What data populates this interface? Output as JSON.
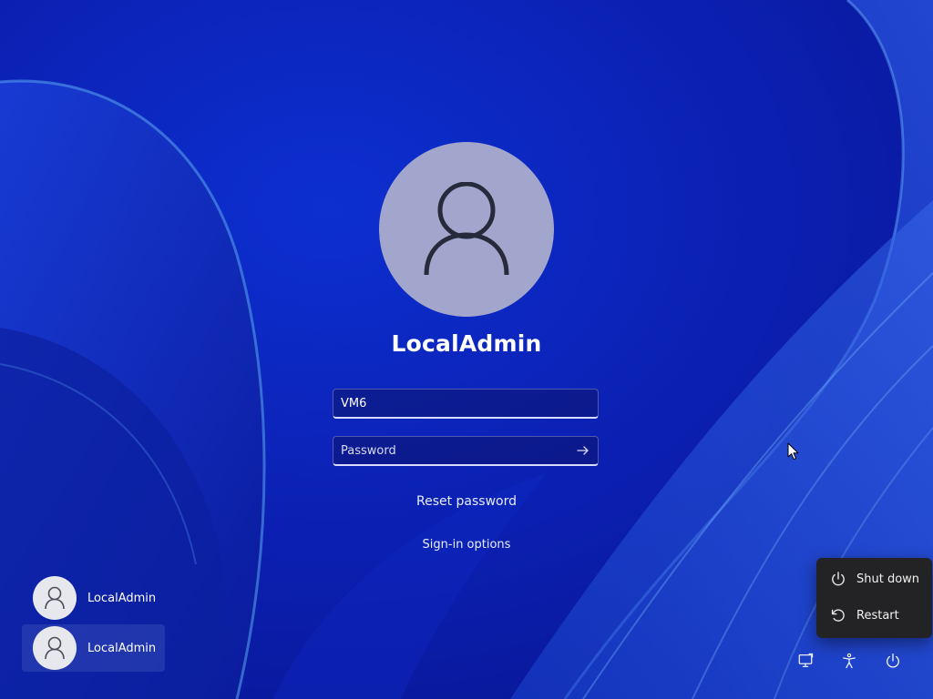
{
  "user": {
    "name": "LocalAdmin"
  },
  "signin": {
    "domain_value": "VM6",
    "password_placeholder": "Password",
    "reset_password": "Reset password",
    "signin_options": "Sign-in options"
  },
  "accounts": [
    {
      "label": "LocalAdmin",
      "selected": false
    },
    {
      "label": "LocalAdmin",
      "selected": true
    }
  ],
  "power_menu": {
    "items": [
      {
        "label": "Shut down",
        "icon": "power-icon"
      },
      {
        "label": "Restart",
        "icon": "restart-icon"
      }
    ]
  },
  "tray": {
    "icons": [
      "network-icon",
      "accessibility-icon",
      "power-icon"
    ]
  },
  "colors": {
    "background": "#0a1ea8",
    "avatar": "#a2a6cc",
    "menu": "#232325"
  }
}
